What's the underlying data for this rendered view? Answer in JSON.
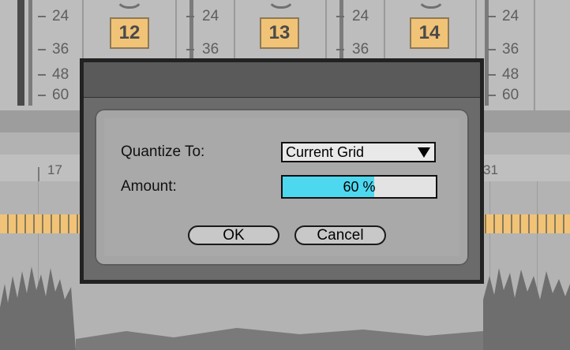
{
  "mixer": {
    "tracks": [
      "12",
      "13",
      "14"
    ],
    "scale_columns": [
      [
        "24",
        "36",
        "48",
        "60"
      ],
      [
        "24",
        "36"
      ],
      [
        "24",
        "36"
      ],
      [
        "24",
        "36",
        "48",
        "60"
      ]
    ]
  },
  "arrangement": {
    "ruler": [
      "17",
      "31"
    ]
  },
  "dialog": {
    "quantize_label": "Quantize To:",
    "quantize_value": "Current Grid",
    "amount_label": "Amount:",
    "amount_value_text": "60 %",
    "amount_percent": 60,
    "ok_label": "OK",
    "cancel_label": "Cancel",
    "colors": {
      "amount_fill": "#4ed8f0",
      "track_box": "#f1c377"
    }
  }
}
